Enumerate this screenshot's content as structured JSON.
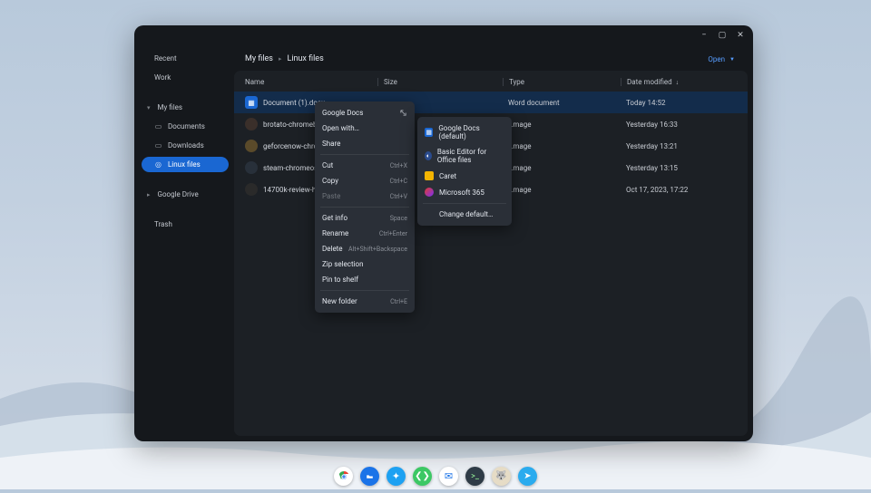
{
  "window_controls": {
    "minimize": "−",
    "maximize": "▢",
    "close": "✕"
  },
  "sidebar": {
    "recent": "Recent",
    "work": "Work",
    "myfiles": "My files",
    "documents": "Documents",
    "downloads": "Downloads",
    "linux": "Linux files",
    "gdrive": "Google Drive",
    "trash": "Trash"
  },
  "breadcrumb": {
    "root": "My files",
    "current": "Linux files"
  },
  "open_label": "Open",
  "columns": {
    "name": "Name",
    "size": "Size",
    "type": "Type",
    "date": "Date modified"
  },
  "rows": [
    {
      "name": "Document (1).docx",
      "type": "Word document",
      "date": "Today 14:52",
      "icon": "doc",
      "iconbg": "#1a67d2"
    },
    {
      "name": "brotato-chromebook-sc…",
      "type": "…mage",
      "date": "Yesterday 16:33",
      "icon": "img",
      "iconbg": "#3a2f2a"
    },
    {
      "name": "geforcenow-chromeos-…",
      "type": "…mage",
      "date": "Yesterday 13:21",
      "icon": "img",
      "iconbg": "#2f3027"
    },
    {
      "name": "steam-chromeos-scree…",
      "type": "…mage",
      "date": "Yesterday 13:15",
      "icon": "img",
      "iconbg": "#28303a"
    },
    {
      "name": "14700k-review-hero.jpg",
      "type": "…mage",
      "date": "Oct 17, 2023, 17:22",
      "icon": "img",
      "iconbg": "#2a2a2a"
    }
  ],
  "context_menu": {
    "google_docs": "Google Docs",
    "open_with": "Open with…",
    "share": "Share",
    "cut": "Cut",
    "cut_sc": "Ctrl+X",
    "copy": "Copy",
    "copy_sc": "Ctrl+C",
    "paste": "Paste",
    "paste_sc": "Ctrl+V",
    "getinfo": "Get info",
    "getinfo_sc": "Space",
    "rename": "Rename",
    "rename_sc": "Ctrl+Enter",
    "delete": "Delete",
    "delete_sc": "Alt+Shift+Backspace",
    "zip": "Zip selection",
    "pin": "Pin to shelf",
    "newfolder": "New folder",
    "newfolder_sc": "Ctrl+E"
  },
  "submenu": {
    "gdocs": "Google Docs (default)",
    "basic": "Basic Editor for Office files",
    "caret": "Caret",
    "ms365": "Microsoft 365",
    "change": "Change default…"
  },
  "shelf": [
    {
      "name": "chrome",
      "bg": "#fff"
    },
    {
      "name": "files",
      "bg": "#1a73e8"
    },
    {
      "name": "twitter",
      "bg": "#1da1f2"
    },
    {
      "name": "whatsapp",
      "bg": "#25d366"
    },
    {
      "name": "messages",
      "bg": "#ffffff"
    },
    {
      "name": "terminal",
      "bg": "#2e3b46"
    },
    {
      "name": "gimp",
      "bg": "#e6dcc6"
    },
    {
      "name": "telegram",
      "bg": "#2aabee"
    }
  ]
}
